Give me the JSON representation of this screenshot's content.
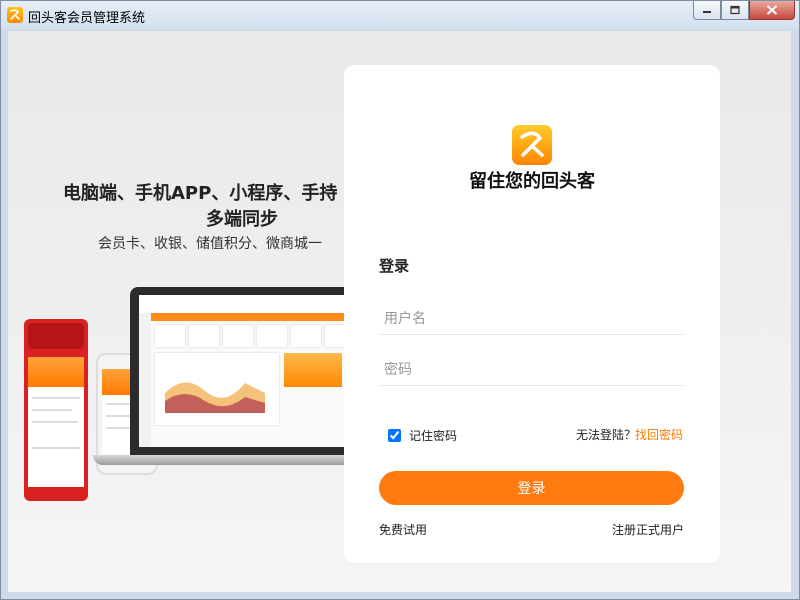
{
  "window": {
    "title": "回头客会员管理系统",
    "app_icon": "runner-logo-icon",
    "controls": [
      "minimize-icon",
      "maximize-icon",
      "close-icon"
    ]
  },
  "promo": {
    "headline_line1": "电脑端、手机APP、小程序、手持",
    "headline_line2": "多端同步",
    "subline": "会员卡、收银、储值积分、微商城一"
  },
  "login": {
    "slogan": "留住您的回头客",
    "title": "登录",
    "username_placeholder": "用户名",
    "password_placeholder": "密码",
    "remember_label": "记住密码",
    "remember_checked": true,
    "cant_login": "无法登陆？",
    "find_password": "找回密码",
    "login_button": "登录",
    "free_trial": "免费试用",
    "register": "注册正式用户"
  },
  "colors": {
    "accent": "#ff7a0f",
    "link": "#ff7a00"
  }
}
